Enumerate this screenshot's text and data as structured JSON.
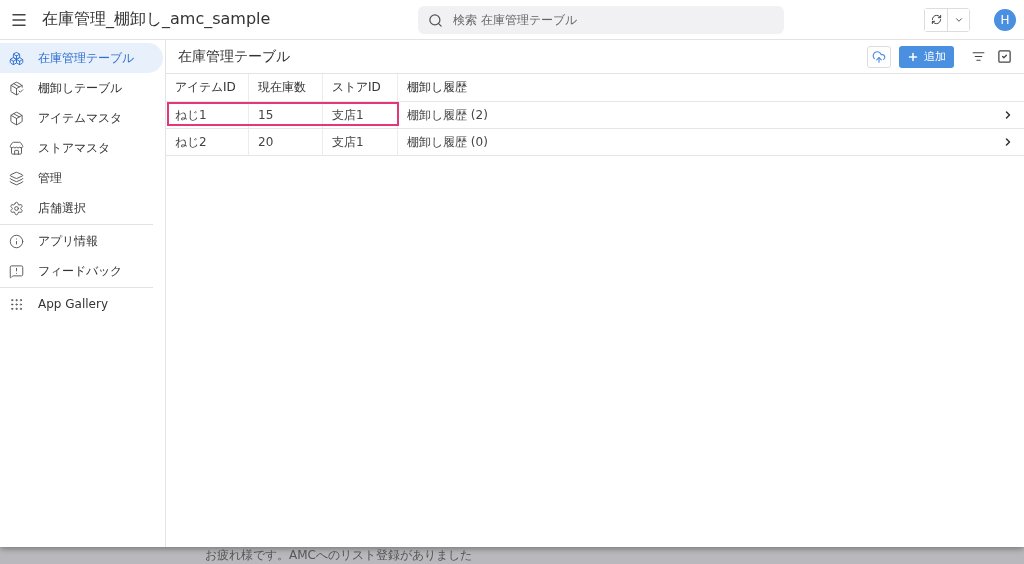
{
  "app_bar": {
    "title": "在庫管理_棚卸し_amc_sample",
    "search": {
      "placeholder": "検索 在庫管理テーブル"
    },
    "avatar": "H"
  },
  "sidebar": {
    "groups": [
      [
        {
          "label": "在庫管理テーブル",
          "selected": true
        },
        {
          "label": "棚卸しテーブル",
          "selected": false
        },
        {
          "label": "アイテムマスタ",
          "selected": false
        },
        {
          "label": "ストアマスタ",
          "selected": false
        },
        {
          "label": "管理",
          "selected": false
        },
        {
          "label": "店舗選択",
          "selected": false
        }
      ],
      [
        {
          "label": "アプリ情報",
          "selected": false
        },
        {
          "label": "フィードバック",
          "selected": false
        }
      ],
      [
        {
          "label": "App Gallery",
          "selected": false
        }
      ]
    ]
  },
  "view": {
    "title": "在庫管理テーブル",
    "add_button": "追加"
  },
  "table": {
    "columns": [
      "アイテムID",
      "現在庫数",
      "ストアID",
      "棚卸し履歴"
    ],
    "rows": [
      {
        "cells": [
          "ねじ1",
          "15",
          "支店1",
          "棚卸し履歴 (2)"
        ],
        "highlighted": true
      },
      {
        "cells": [
          "ねじ2",
          "20",
          "支店1",
          "棚卸し履歴 (0)"
        ],
        "highlighted": false
      }
    ]
  },
  "backdrop": {
    "text": "お疲れ様です。AMCへのリスト登録がありました"
  }
}
